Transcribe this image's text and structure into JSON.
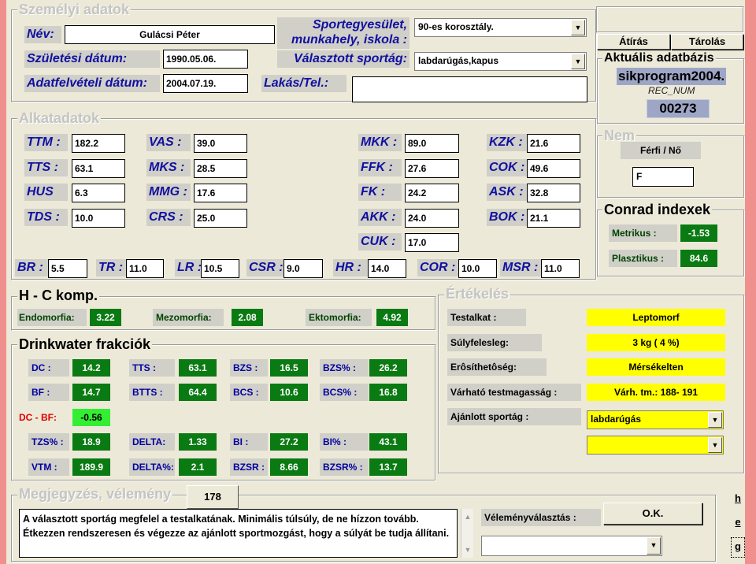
{
  "personal": {
    "title": "Személyi adatok",
    "name_label": "Név:",
    "name_value": "Gulácsi Péter",
    "birth_label": "Születési dátum:",
    "birth_value": "1990.05.06.",
    "intake_label": "Adatfelvételi dátum:",
    "intake_value": "2004.07.19.",
    "club_label_line1": "Sportegyesület,",
    "club_label_line2": "munkahely, iskola :",
    "club_value": "90-es korosztály.",
    "sport_label": "Választott sportág:",
    "sport_value": "labdarúgás,kapus",
    "address_label": "Lakás/Tel.:",
    "address_value": ""
  },
  "buttons": {
    "atiras": "Átírás",
    "tarolas": "Tárolás",
    "ok": "O.K."
  },
  "database": {
    "title": "Aktuális adatbázis",
    "name": "sikprogram2004.",
    "rec_label": "REC_NUM",
    "rec_value": "00273"
  },
  "gender": {
    "title": "Nem",
    "label": "Férfi / Nő",
    "value": "F"
  },
  "body": {
    "title": "Alkatadatok",
    "fields": [
      {
        "label": "TTM :",
        "value": "182.2"
      },
      {
        "label": "TTS :",
        "value": "63.1"
      },
      {
        "label": "HUS",
        "value": "6.3"
      },
      {
        "label": "TDS :",
        "value": "10.0"
      },
      {
        "label": "VAS :",
        "value": "39.0"
      },
      {
        "label": "MKS :",
        "value": "28.5"
      },
      {
        "label": "MMG :",
        "value": "17.6"
      },
      {
        "label": "CRS :",
        "value": "25.0"
      },
      {
        "label": "MKK :",
        "value": "89.0"
      },
      {
        "label": "FFK :",
        "value": "27.6"
      },
      {
        "label": "FK :",
        "value": "24.2"
      },
      {
        "label": "AKK :",
        "value": "24.0"
      },
      {
        "label": "CUK :",
        "value": "17.0"
      },
      {
        "label": "KZK :",
        "value": "21.6"
      },
      {
        "label": "COK :",
        "value": "49.6"
      },
      {
        "label": "ASK :",
        "value": "32.8"
      },
      {
        "label": "BOK :",
        "value": "21.1"
      }
    ],
    "row": [
      {
        "label": "BR :",
        "value": "5.5"
      },
      {
        "label": "TR :",
        "value": "11.0"
      },
      {
        "label": "LR :",
        "value": "10.5"
      },
      {
        "label": "CSR :",
        "value": "9.0"
      },
      {
        "label": "HR :",
        "value": "14.0"
      },
      {
        "label": "COR :",
        "value": "10.0"
      },
      {
        "label": "MSR :",
        "value": "11.0"
      }
    ]
  },
  "conrad": {
    "title": "Conrad indexek",
    "metrikus_label": "Metrikus :",
    "metrikus_value": "-1.53",
    "plasztikus_label": "Plasztikus :",
    "plasztikus_value": "84.6"
  },
  "hc": {
    "title": "H - C komp.",
    "endo_label": "Endomorfia:",
    "endo_value": "3.22",
    "mezo_label": "Mezomorfia:",
    "mezo_value": "2.08",
    "ekto_label": "Ektomorfia:",
    "ekto_value": "4.92"
  },
  "drinkwater": {
    "title": "Drinkwater frakciók",
    "cells": [
      {
        "label": "DC :",
        "value": "14.2"
      },
      {
        "label": "TTS :",
        "value": "63.1"
      },
      {
        "label": "BZS :",
        "value": "16.5"
      },
      {
        "label": "BZS% :",
        "value": "26.2"
      },
      {
        "label": "BF :",
        "value": "14.7"
      },
      {
        "label": "BTTS :",
        "value": "64.4"
      },
      {
        "label": "BCS :",
        "value": "10.6"
      },
      {
        "label": "BCS% :",
        "value": "16.8"
      },
      {
        "label": "DC - BF:",
        "value": "-0.56"
      },
      {
        "label": "TZS% :",
        "value": "18.9"
      },
      {
        "label": "DELTA:",
        "value": "1.33"
      },
      {
        "label": "BI :",
        "value": "27.2"
      },
      {
        "label": "BI% :",
        "value": "43.1"
      },
      {
        "label": "VTM :",
        "value": "189.9"
      },
      {
        "label": "DELTA%:",
        "value": "2.1"
      },
      {
        "label": "BZSR :",
        "value": "8.66"
      },
      {
        "label": "BZSR% :",
        "value": "13.7"
      }
    ]
  },
  "eval": {
    "title": "Értékelés",
    "testalkat_label": "Testalkat :",
    "testalkat_value": "Leptomorf",
    "suly_label": "Súlyfelesleg:",
    "suly_value": "3 kg  ( 4 %)",
    "erosit_label": "Erôsíthetôség:",
    "erosit_value": "Mérsékelten",
    "varhato_label": "Várható testmagasság :",
    "varhato_value": "Várh. tm.: 188- 191",
    "ajanlott_label": "Ajánlott sportág :",
    "ajanlott_value": "labdarúgás",
    "ajanlott2_value": ""
  },
  "notes": {
    "title": "Megjegyzés, vélemény",
    "count": "178",
    "text": "A választott sportág megfelel a testalkatának. Minimális túlsúly, de ne hízzon tovább. Étkezzen rendszeresen és végezze az ajánlott sportmozgást, hogy a súlyát be tudja állítani.",
    "opinion_label": "Véleményválasztás :",
    "opinion_value": ""
  },
  "side": {
    "h": "h",
    "e": "e",
    "g": "g"
  },
  "colors": {
    "green": "#0a7a12",
    "lightgreen": "#33ee33",
    "yellow": "#ffff00",
    "side": "#f0908e"
  }
}
